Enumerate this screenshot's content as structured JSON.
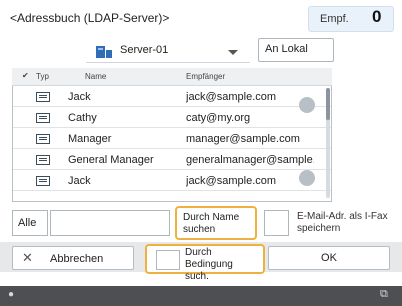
{
  "header": {
    "title": "<Adressbuch (LDAP-Server)>",
    "empf_label": "Empf.",
    "empf_count": "0"
  },
  "server": {
    "selected": "Server-01",
    "icon": "server-icon",
    "lokal_label": "An Lokal"
  },
  "list": {
    "columns": [
      "Typ",
      "Name",
      "Empfänger"
    ],
    "rows": [
      {
        "name": "Jack",
        "email": "jack@sample.com"
      },
      {
        "name": "Cathy",
        "email": "caty@my.org"
      },
      {
        "name": "Manager",
        "email": "manager@sample.com"
      },
      {
        "name": "General Manager",
        "email": "generalmanager@sample..."
      },
      {
        "name": "Jack",
        "email": "jack@sample.com"
      }
    ]
  },
  "search": {
    "alle_label": "Alle",
    "search_value": "",
    "by_name_label": "Durch Name suchen",
    "ifax_label": "E-Mail-Adr. als I-Fax speichern"
  },
  "actions": {
    "cancel_label": "Abbrechen",
    "condition_label": "Durch Bedingung such.",
    "ok_label": "OK"
  },
  "colors": {
    "accent": "#f0b040",
    "empf_bg": "#e9f2fb",
    "footer_bg": "#4d4f52"
  }
}
